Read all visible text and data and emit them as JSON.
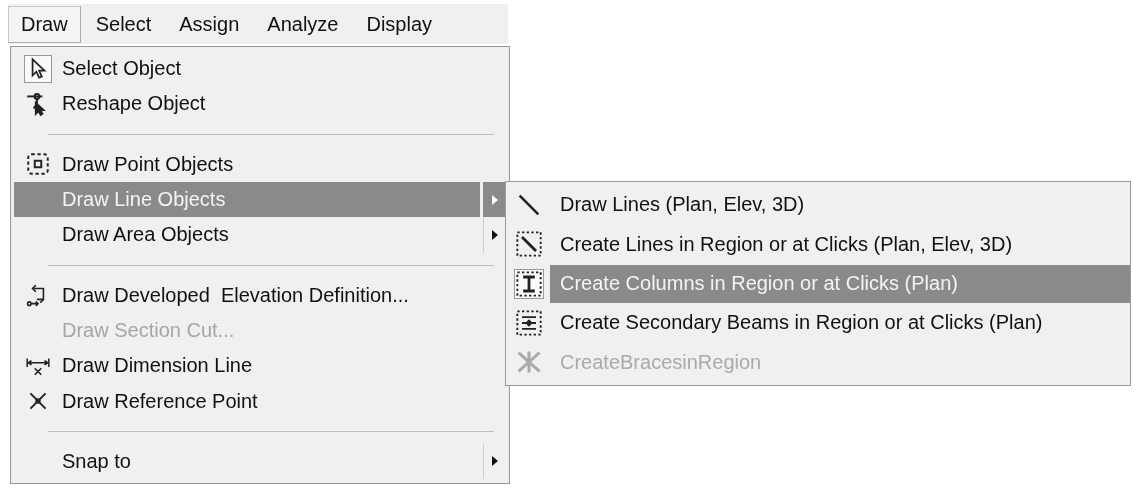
{
  "menu_bar": [
    {
      "label": "Draw",
      "selected": true
    },
    {
      "label": "Select",
      "selected": false
    },
    {
      "label": "Assign",
      "selected": false
    },
    {
      "label": "Analyze",
      "selected": false
    },
    {
      "label": "Display",
      "selected": false
    }
  ],
  "draw_menu": [
    {
      "kind": "command",
      "label": "Select Object",
      "checked": true,
      "selected": false,
      "disabled": false
    },
    {
      "kind": "command",
      "label": "Reshape Object",
      "checked": false,
      "selected": false,
      "disabled": false
    },
    {
      "kind": "separator"
    },
    {
      "kind": "command",
      "label": "Draw Point Objects",
      "checked": false,
      "selected": false,
      "disabled": false
    },
    {
      "kind": "submenu",
      "label": "Draw Line Objects",
      "selected": true,
      "disabled": false
    },
    {
      "kind": "submenu",
      "label": "Draw Area Objects",
      "selected": false,
      "disabled": false
    },
    {
      "kind": "separator"
    },
    {
      "kind": "command",
      "label": "Draw Developed  Elevation Definition...",
      "checked": false,
      "selected": false,
      "disabled": false
    },
    {
      "kind": "command",
      "label": "Draw Section Cut...",
      "selected": false,
      "disabled": true
    },
    {
      "kind": "command",
      "label": "Draw Dimension Line",
      "checked": false,
      "selected": false,
      "disabled": false
    },
    {
      "kind": "command",
      "label": "Draw Reference Point",
      "checked": false,
      "selected": false,
      "disabled": false
    },
    {
      "kind": "separator"
    },
    {
      "kind": "submenu",
      "label": "Snap to",
      "selected": false,
      "disabled": false
    }
  ],
  "line_submenu": [
    {
      "label": "Draw Lines (Plan, Elev, 3D)",
      "checked": false,
      "selected": false,
      "disabled": false
    },
    {
      "label": "Create Lines in Region or at Clicks (Plan, Elev, 3D)",
      "checked": false,
      "selected": false,
      "disabled": false
    },
    {
      "label": "Create Columns in Region or at Clicks (Plan)",
      "checked": true,
      "selected": true,
      "disabled": false
    },
    {
      "label": "Create Secondary Beams in Region or at Clicks (Plan)",
      "checked": false,
      "selected": false,
      "disabled": false
    },
    {
      "label": "CreateBracesinRegion",
      "checked": false,
      "selected": false,
      "disabled": true
    }
  ]
}
